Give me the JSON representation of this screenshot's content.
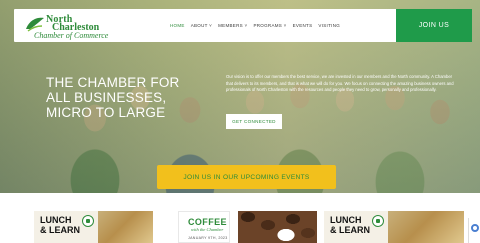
{
  "header": {
    "logo": {
      "line1": "North",
      "line2": "Charleston",
      "line3": "Chamber of Commerce"
    },
    "nav": [
      {
        "label": "HOME"
      },
      {
        "label": "ABOUT ˅"
      },
      {
        "label": "MEMBERS ˅"
      },
      {
        "label": "PROGRAMS ˅"
      },
      {
        "label": "EVENTS"
      },
      {
        "label": "VISITING"
      }
    ],
    "join_label": "JOIN US"
  },
  "hero": {
    "title": "THE CHAMBER FOR ALL BUSINESSES, MICRO TO LARGE",
    "text": "Our vision is to offer our members the best service, we are invested in our members and the North community. A Chamber that delivers to its members, and that is what we will do for you. We focus on connecting the amazing business owners and professionals of North Charleston with the resources and people they need to grow, personally and professionally.",
    "cta_label": "GET CONNECTED"
  },
  "events_button": {
    "label": "JOIN US IN OUR UPCOMING EVENTS"
  },
  "cards": {
    "lunch1": {
      "line1": "LUNCH",
      "line2": "& LEARN"
    },
    "coffee": {
      "title": "COFFEE",
      "sub": "with the Chamber",
      "date": "JANUARY 9TH, 2023"
    },
    "lunch2": {
      "line1": "LUNCH",
      "line2": "& LEARN"
    }
  },
  "colors": {
    "brand_green": "#1f9b4a",
    "accent_yellow": "#f2c01c"
  }
}
